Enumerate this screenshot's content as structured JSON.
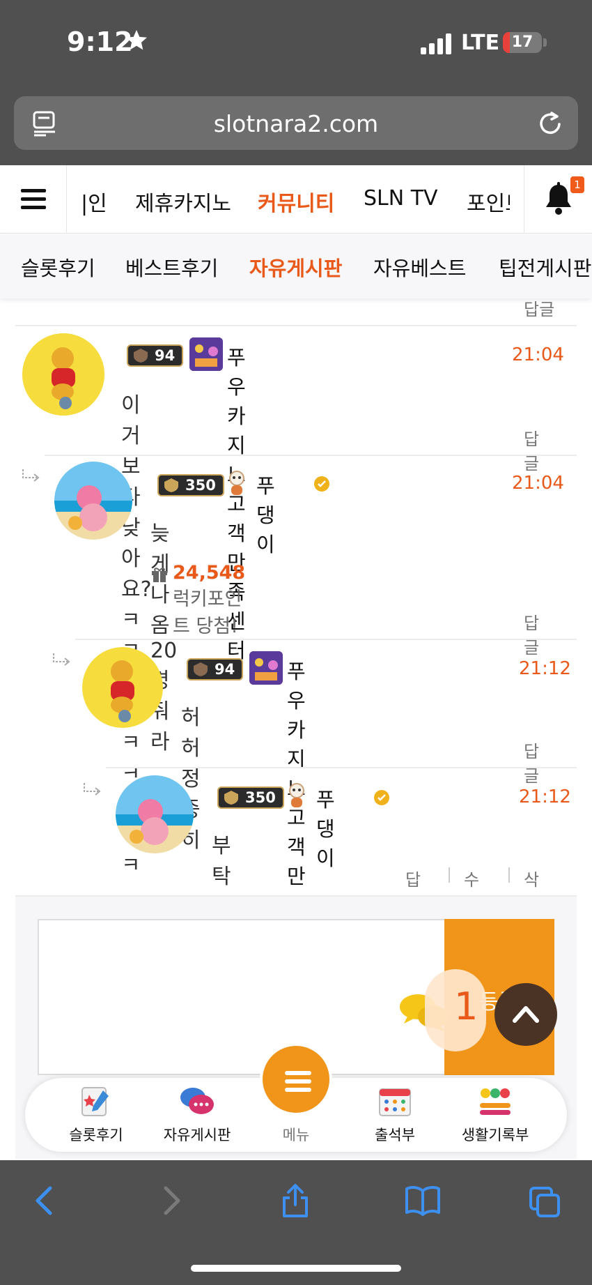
{
  "status_bar": {
    "time": "9:12",
    "network": "LTE",
    "battery": "17",
    "battery_level": 0.17
  },
  "browser": {
    "url": "slotnara2.com"
  },
  "nav": {
    "items": [
      "|인",
      "제휴카지노",
      "커뮤니티",
      "SLN TV",
      "포인트"
    ],
    "active": "커뮤니티",
    "bell_badge": "1"
  },
  "sub_nav": {
    "items": [
      "슬롯후기",
      "베스트후기",
      "자유게시판",
      "자유베스트",
      "팁전게시판"
    ],
    "active": "자유게시판"
  },
  "comments": [
    {
      "level": "94",
      "nickname": "푸우카지노고객만족센터",
      "time": "21:04",
      "text": "이거보다 낮아요?ㅋㅋㅋㅋㅋㅋㅋㅋㅋ",
      "reply": "답글"
    },
    {
      "level": "350",
      "nickname": "푸댕이",
      "time": "21:04",
      "text": "늦게나옴 20명줘라",
      "prize_value": "24,548",
      "prize_text": "럭키포인트 당첨!",
      "reply": "답글"
    },
    {
      "level": "94",
      "nickname": "푸우카지노고객만족센터",
      "time": "21:12",
      "text": "허허 정중히",
      "reply": "답글"
    },
    {
      "level": "350",
      "nickname": "푸댕이",
      "time": "21:12",
      "text": "부탁두리겠습니다",
      "reply": "답글",
      "edit": "수정",
      "delete": "삭제"
    }
  ],
  "top_reply_partial": "답글",
  "write": {
    "submit": "등록",
    "count": "1"
  },
  "quick_menu": {
    "items": [
      "슬롯후기",
      "자유게시판",
      "메뉴",
      "출석부",
      "생활기록부"
    ]
  },
  "colors": {
    "accent": "#e8591a",
    "button": "#f0951a",
    "chrome": "#505050"
  }
}
